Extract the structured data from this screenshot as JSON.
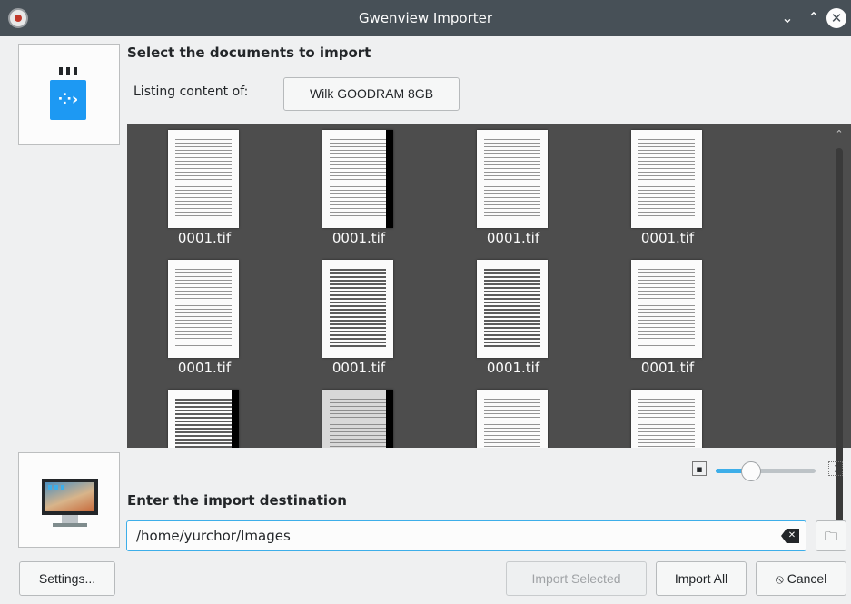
{
  "window": {
    "title": "Gwenview Importer",
    "controls": {
      "minimize": "⌄",
      "maximize": "⌃",
      "close": "✕"
    }
  },
  "source": {
    "heading": "Select the documents to import",
    "listing_label": "Listing content of:",
    "device_button": "Wilk GOODRAM 8GB",
    "device_icon": "usb-drive-icon"
  },
  "thumbnails": [
    {
      "name": "0001.tif"
    },
    {
      "name": "0001.tif"
    },
    {
      "name": "0001.tif"
    },
    {
      "name": "0001.tif"
    },
    {
      "name": "0001.tif"
    },
    {
      "name": "0001.tif"
    },
    {
      "name": "0001.tif"
    },
    {
      "name": "0001.tif"
    },
    {
      "name": ""
    },
    {
      "name": ""
    },
    {
      "name": ""
    },
    {
      "name": ""
    }
  ],
  "zoom": {
    "level": 0.35,
    "zoom_in_icon": "zoom-fit-icon",
    "zoom_out_icon": "zoom-full-icon"
  },
  "destination": {
    "heading": "Enter the import destination",
    "path": "/home/yurchor/Images",
    "destination_icon": "computer-icon",
    "clear_icon": "edit-clear-icon",
    "browse_icon": "folder-icon"
  },
  "buttons": {
    "settings": "Settings...",
    "import_selected": "Import Selected",
    "import_all": "Import All",
    "cancel": "⦸ Cancel"
  },
  "colors": {
    "titlebar": "#475057",
    "accent": "#3daee9",
    "grid_background": "#4d4d4d",
    "window_background": "#eff0f1"
  }
}
